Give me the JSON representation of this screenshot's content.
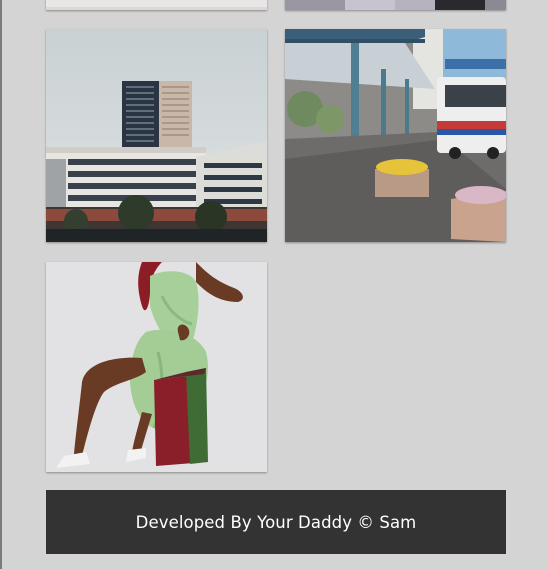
{
  "gallery": {
    "images": [
      {
        "name": "partial-light-image"
      },
      {
        "name": "partial-dark-image"
      },
      {
        "name": "city-buildings-photo"
      },
      {
        "name": "bus-stop-photo"
      },
      {
        "name": "woman-green-dress-photo"
      }
    ]
  },
  "footer": {
    "text": "Developed By Your Daddy © Sam"
  },
  "colors": {
    "background": "#d4d4d4",
    "footer_background": "#333333",
    "footer_text": "#ffffff"
  }
}
